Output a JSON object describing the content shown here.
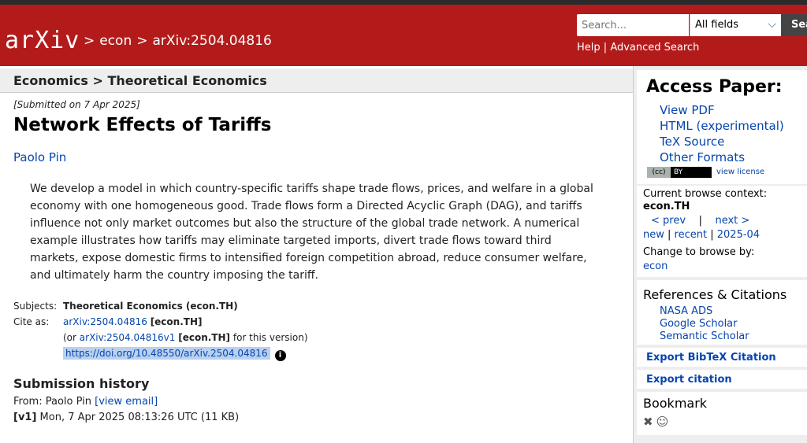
{
  "header": {
    "logo_text": "arXiv",
    "breadcrumbs": [
      ">",
      "econ",
      ">",
      "arXiv:2504.04816"
    ],
    "search_placeholder": "Search...",
    "search_field": "All fields",
    "search_button": "Sea",
    "help_link": "Help",
    "help_sep": "|",
    "advanced_link": "Advanced Search"
  },
  "subject_bar": "Economics > Theoretical Economics",
  "paper": {
    "submitted": "[Submitted on 7 Apr 2025]",
    "title": "Network Effects of Tariffs",
    "author": "Paolo Pin",
    "abstract": "We develop a model in which country-specific tariffs shape trade flows, prices, and welfare in a global economy with one homogeneous good. Trade flows form a Directed Acyclic Graph (DAG), and tariffs influence not only market outcomes but also the structure of the global trade network. A numerical example illustrates how tariffs may eliminate targeted imports, divert trade flows toward third markets, expose domestic firms to intensified foreign competition abroad, reduce consumer welfare, and ultimately harm the country imposing the tariff."
  },
  "meta": {
    "subjects_label": "Subjects:",
    "subjects_value": "Theoretical Economics (econ.TH)",
    "cite_label": "Cite as:",
    "cite_id": "arXiv:2504.04816",
    "cite_cat": "[econ.TH]",
    "or_prefix": "(or",
    "version_id": "arXiv:2504.04816v1",
    "version_cat": "[econ.TH]",
    "version_suffix": "for this version)",
    "doi": "https://doi.org/10.48550/arXiv.2504.04816",
    "info_glyph": "i"
  },
  "history": {
    "title": "Submission history",
    "from_prefix": "From: Paolo Pin",
    "view_email": "[view email]",
    "v1_label": "[v1]",
    "v1_text": "Mon, 7 Apr 2025 08:13:26 UTC (11 KB)"
  },
  "sidebar": {
    "access_title": "Access Paper:",
    "access_links": [
      "View PDF",
      "HTML (experimental)",
      "TeX Source",
      "Other Formats"
    ],
    "cc_left": "(cc)",
    "cc_right": "BY",
    "view_license": "view license",
    "context_label": "Current browse context:",
    "context_value": "econ.TH",
    "prev": "< prev",
    "nav_sep": "|",
    "next": "next >",
    "new": "new",
    "recent": "recent",
    "month": "2025-04",
    "change_label": "Change to browse by:",
    "change_value": "econ",
    "refs_title": "References & Citations",
    "refs_links": [
      "NASA ADS",
      "Google Scholar",
      "Semantic Scholar"
    ],
    "bibtex": "Export BibTeX Citation",
    "export_citation": "Export citation",
    "bookmark_title": "Bookmark",
    "bookmark_icons": [
      "bibsonomy-icon",
      "reddit-icon"
    ]
  },
  "colors": {
    "header_red": "#b31b1b",
    "link_blue": "#0645ad",
    "doi_highlight": "#b9d0ef"
  }
}
